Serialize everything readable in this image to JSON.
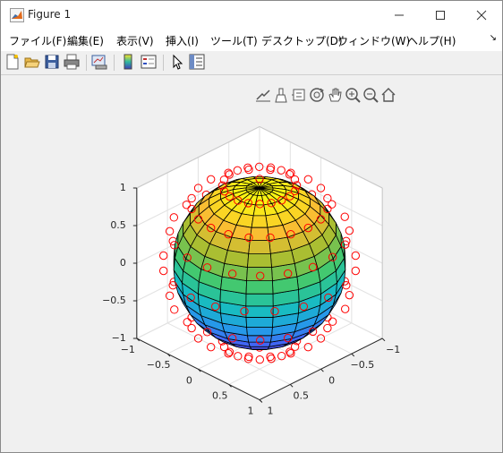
{
  "window": {
    "title": "Figure 1"
  },
  "menu": {
    "items": [
      {
        "label": "ファイル(F)"
      },
      {
        "label": "編集(E)"
      },
      {
        "label": "表示(V)"
      },
      {
        "label": "挿入(I)"
      },
      {
        "label": "ツール(T)"
      },
      {
        "label": "デスクトップ(D)"
      },
      {
        "label": "ウィンドウ(W)"
      },
      {
        "label": "ヘルプ(H)"
      }
    ]
  },
  "toolbar": {
    "icons": [
      "new-figure-icon",
      "open-file-icon",
      "save-icon",
      "print-icon",
      "link-plot-icon",
      "insert-colorbar-icon",
      "insert-legend-icon",
      "edit-plot-icon",
      "property-inspector-icon"
    ]
  },
  "axes_toolbar": {
    "icons": [
      "export-icon",
      "brush-icon",
      "data-tips-icon",
      "rotate-3d-icon",
      "pan-icon",
      "zoom-in-icon",
      "zoom-out-icon",
      "home-icon"
    ]
  },
  "chart_data": {
    "type": "scatter",
    "description_type": "3d-surface-with-scatter",
    "surface": {
      "shape": "unit sphere",
      "colormap": "parula",
      "edge_color": "#000000"
    },
    "marker": {
      "symbol": "circle",
      "color": "#ff0000"
    },
    "axes": {
      "x": {
        "range": [
          -1,
          1
        ],
        "tick_labels": [
          "−1",
          "−0.5",
          "0",
          "0.5",
          "1"
        ]
      },
      "y": {
        "range": [
          -1,
          1
        ],
        "tick_labels": [
          "−1",
          "−0.5",
          "0",
          "0.5",
          "1"
        ]
      },
      "z": {
        "range": [
          -1,
          1
        ],
        "tick_labels": [
          "−1",
          "−0.5",
          "0",
          "0.5",
          "1"
        ]
      }
    },
    "grid": true
  }
}
